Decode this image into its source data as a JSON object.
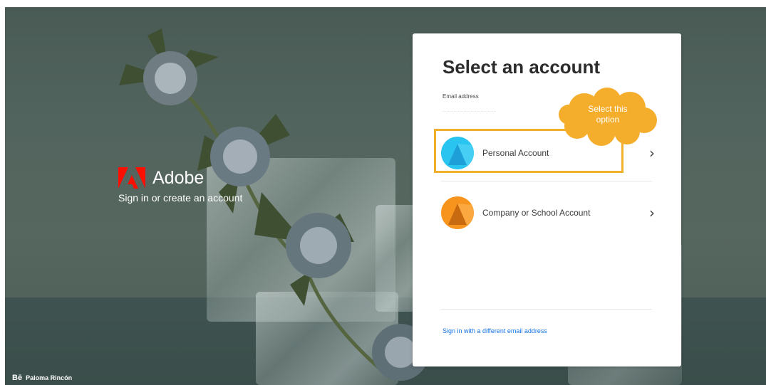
{
  "brand": {
    "name": "Adobe",
    "tagline": "Sign in or create an account",
    "logo": "adobe-logo-icon",
    "logo_color": "#fa0f00"
  },
  "credit": {
    "network_icon": "behance-icon",
    "network_glyph": "Bē",
    "author": "Paloma Rincón"
  },
  "card": {
    "title": "Select an account",
    "email_label": "Email address",
    "accounts": [
      {
        "label": "Personal Account",
        "icon": "personal-account-icon",
        "color": "#2ac4f0",
        "chevron": "›"
      },
      {
        "label": "Company or School Account",
        "icon": "company-account-icon",
        "color": "#f7941d",
        "chevron": "›"
      }
    ],
    "different_email_link": "Sign in with a different email address",
    "link_color": "#1473e6"
  },
  "annotation": {
    "callout_line1": "Select this",
    "callout_line2": "option",
    "color": "#f0b02d"
  }
}
